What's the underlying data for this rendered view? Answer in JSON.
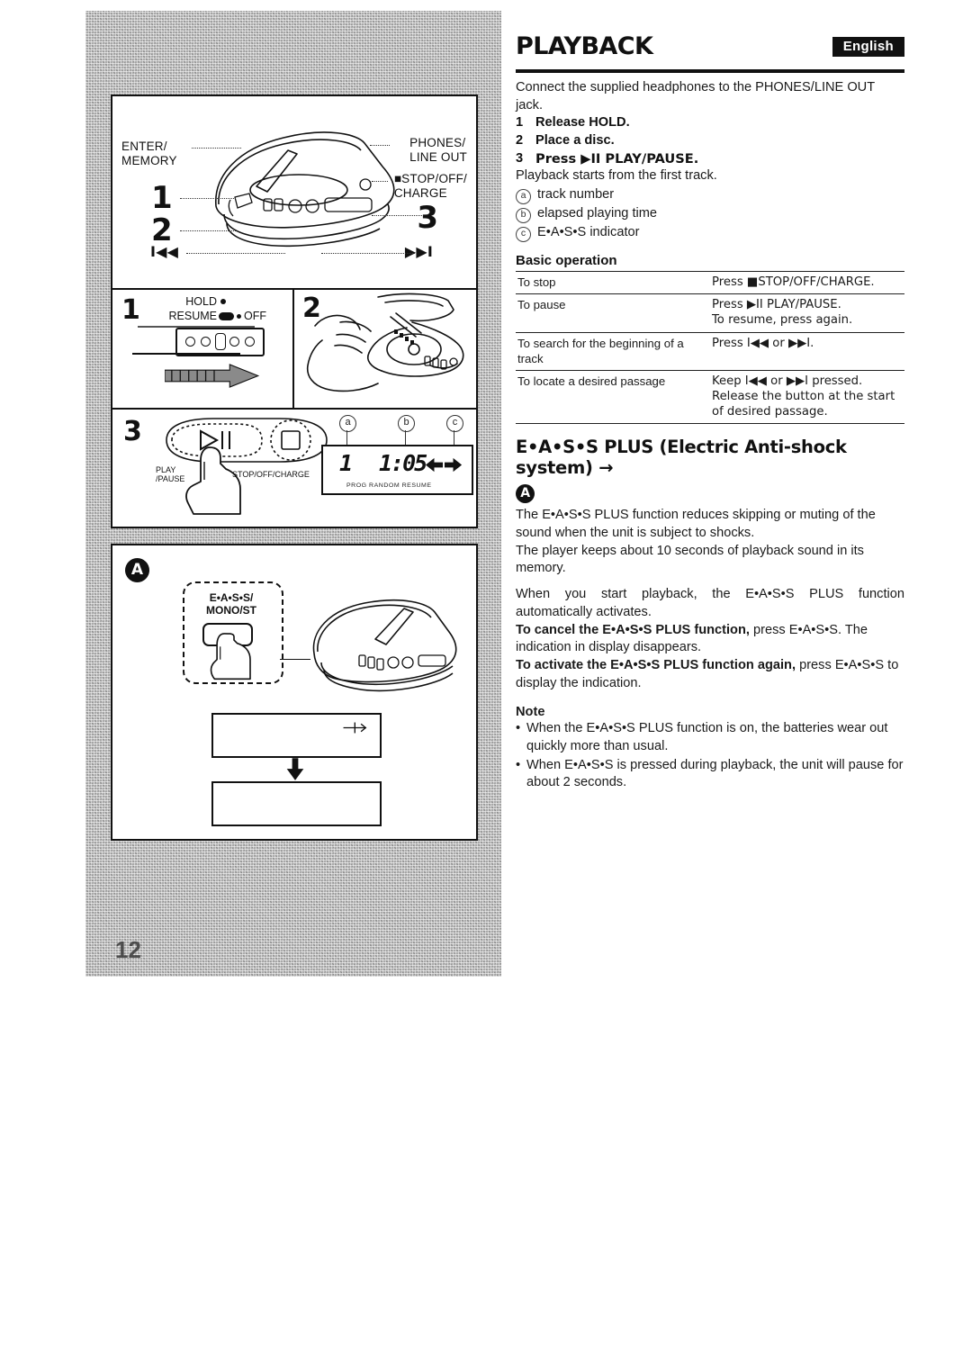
{
  "header": {
    "title": "PLAYBACK",
    "language_badge": "English"
  },
  "intro": {
    "lead": "Connect the supplied headphones to the PHONES/LINE OUT jack.",
    "steps": [
      {
        "num": "1",
        "text": "Release HOLD."
      },
      {
        "num": "2",
        "text": "Place a disc."
      },
      {
        "num": "3",
        "text": "Press ▶II PLAY/PAUSE."
      }
    ],
    "after_steps": "Playback starts from the first track.",
    "legend": [
      {
        "marker": "a",
        "text": "track number"
      },
      {
        "marker": "b",
        "text": "elapsed playing time"
      },
      {
        "marker": "c",
        "text": "E•A•S•S indicator"
      }
    ]
  },
  "basic_operation": {
    "heading": "Basic operation",
    "rows": [
      {
        "action": "To stop",
        "instruction": "Press ■STOP/OFF/CHARGE."
      },
      {
        "action": "To pause",
        "instruction": "Press ▶II PLAY/PAUSE.\nTo resume, press again."
      },
      {
        "action": "To search for the beginning of a track",
        "instruction": "Press I◀◀ or ▶▶I."
      },
      {
        "action": "To locate a desired passage",
        "instruction": "Keep I◀◀ or ▶▶I pressed.\nRelease the button at the start of desired passage."
      }
    ]
  },
  "eass": {
    "heading": "E•A•S•S PLUS (Electric Anti-shock system) →",
    "heading_badge": "A",
    "para1": "The E•A•S•S PLUS function reduces skipping or muting of the sound when the unit is subject to shocks.",
    "para2": "The player keeps about 10 seconds of playback sound in its memory.",
    "para3": "When you start playback, the E•A•S•S PLUS function automatically activates.",
    "cancel_bold": "To cancel the E•A•S•S PLUS function,",
    "cancel_rest": " press E•A•S•S. The indication  in display disappears.",
    "activate_bold": "To activate the E•A•S•S PLUS function again,",
    "activate_rest": " press E•A•S•S to display the indication.",
    "note_heading": "Note",
    "notes": [
      "When the E•A•S•S PLUS function is on, the batteries wear out quickly more than usual.",
      "When  E•A•S•S is pressed during playback, the unit will pause for about 2 seconds."
    ]
  },
  "figures": {
    "page_number": "12",
    "top_panel": {
      "label_enter_memory": "ENTER/\nMEMORY",
      "label_phones": "PHONES/\nLINE OUT",
      "label_stop": "■STOP/OFF/\nCHARGE",
      "num_1": "1",
      "num_2": "2",
      "num_3": "3",
      "glyph_prev": "I◀◀",
      "glyph_next": "▶▶I"
    },
    "panel1": {
      "num": "1",
      "hold_label": "HOLD",
      "resume_label": "RESUME",
      "off_label": "OFF"
    },
    "panel2": {
      "num": "2"
    },
    "panel3": {
      "num": "3",
      "play_pause_label": "PLAY\n/PAUSE",
      "stop_label": "STOP/OFF/CHARGE",
      "marker_a": "a",
      "marker_b": "b",
      "marker_c": "c",
      "display_track": "1",
      "display_time": "1:05",
      "display_indicators": "PROG  RANDOM  RESUME"
    },
    "panel_a": {
      "badge": "A",
      "button_label": "E•A•S•S/\nMONO/ST"
    }
  }
}
